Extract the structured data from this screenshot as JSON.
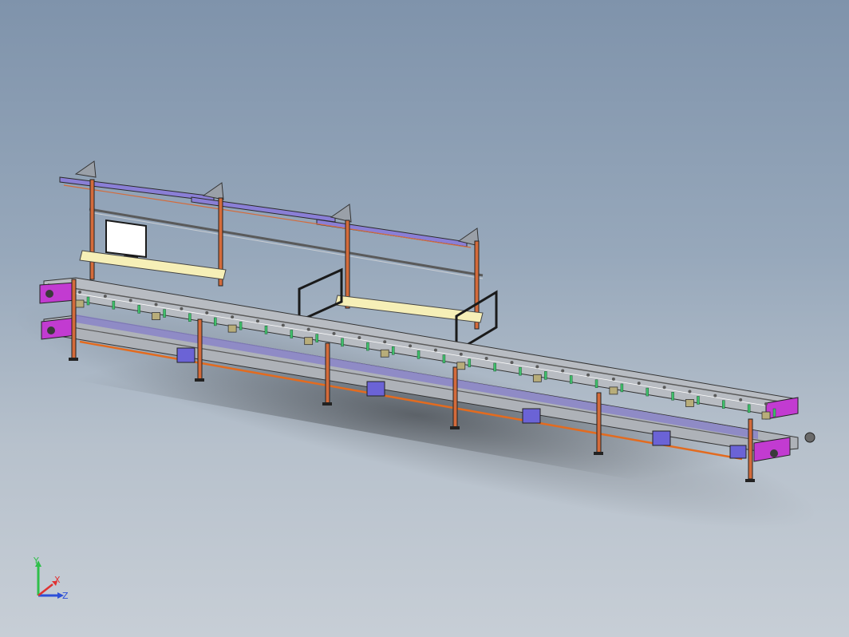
{
  "viewport": {
    "background_top": "#7f93ab",
    "background_bottom": "#c7ced6"
  },
  "model": {
    "colors": {
      "frame_rail": "#aeb2b8",
      "frame_dark": "#3a3a3a",
      "upright": "#d46b3b",
      "shelf": "#f6efb7",
      "top_beam": "#8a7fd6",
      "end_cap": "#c23bd1",
      "motor_box": "#6b63d6",
      "fixture_green": "#3fbf6b",
      "fixture_tan": "#b8ad7a",
      "orange_rail": "#e36b1f",
      "monitor_frame": "#1a1a1a"
    }
  },
  "triad": {
    "y_label": "Y",
    "x_label": "X",
    "z_label": "Z",
    "y_color": "#2fbf4a",
    "x_color": "#e03232",
    "z_color": "#2d4fd8"
  }
}
